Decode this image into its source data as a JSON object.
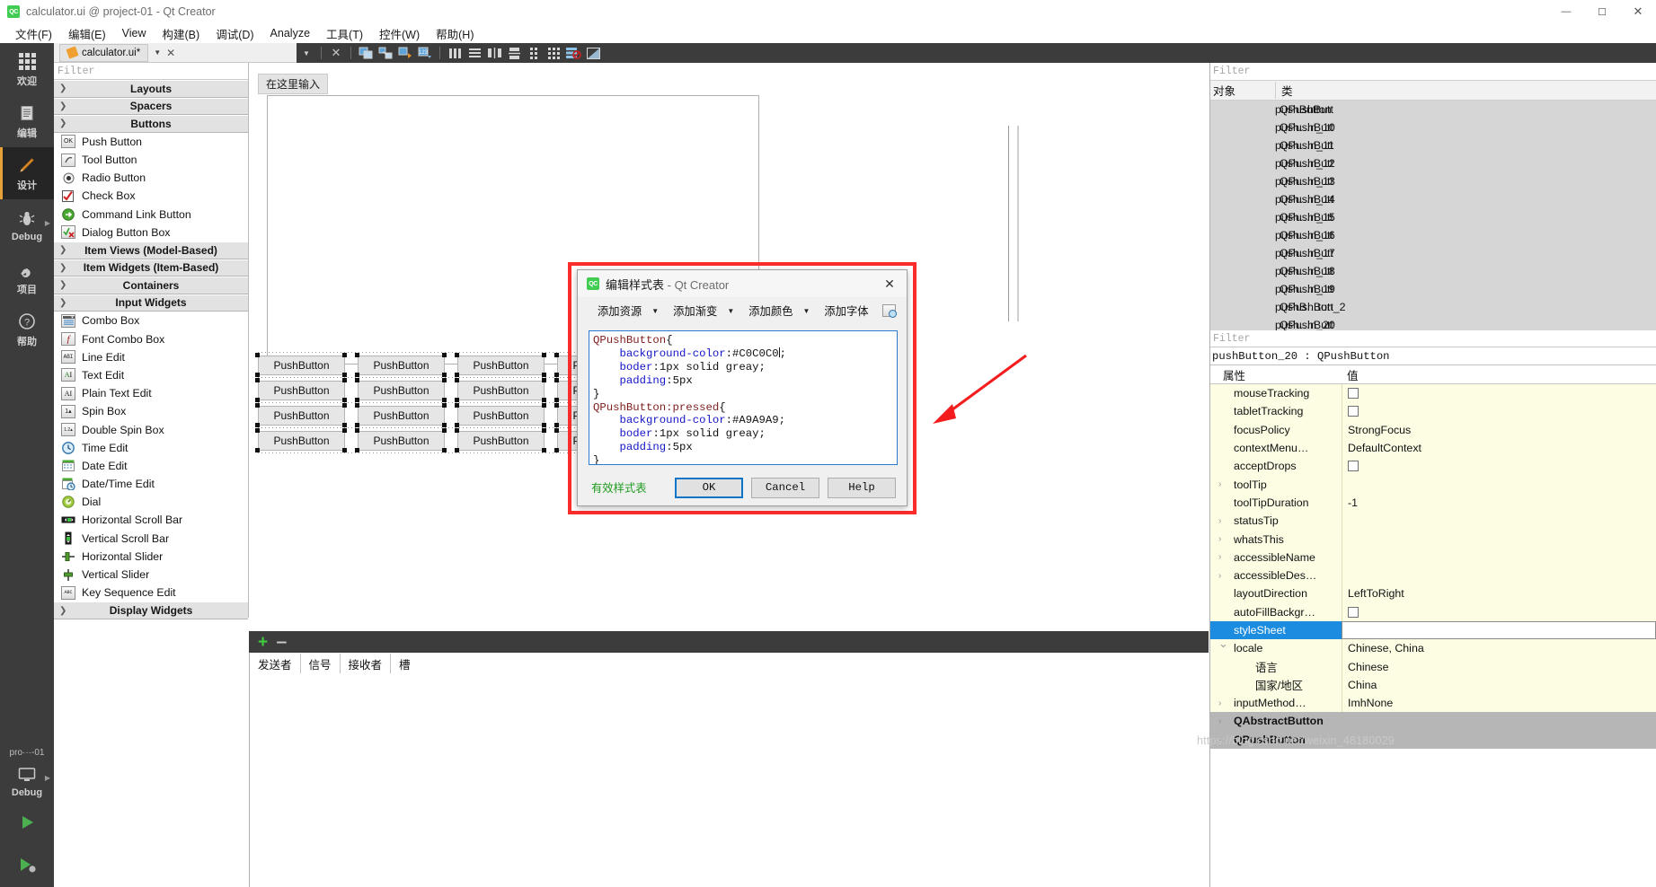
{
  "window": {
    "title": "calculator.ui @ project-01 - Qt Creator",
    "logo_text": "QC",
    "minimize": "—",
    "maximize": "☐",
    "close": "✕"
  },
  "menubar": {
    "items": [
      {
        "label": "文件(F)"
      },
      {
        "label": "编辑(E)"
      },
      {
        "label": "View"
      },
      {
        "label": "构建(B)"
      },
      {
        "label": "调试(D)"
      },
      {
        "label": "Analyze"
      },
      {
        "label": "工具(T)"
      },
      {
        "label": "控件(W)"
      },
      {
        "label": "帮助(H)"
      }
    ]
  },
  "modebar": {
    "items": [
      {
        "label": "欢迎",
        "icon": "grid-icon",
        "active": false,
        "arrow": false
      },
      {
        "label": "编辑",
        "icon": "document-icon",
        "active": false,
        "arrow": false
      },
      {
        "label": "设计",
        "icon": "pencil-icon",
        "active": true,
        "arrow": false
      },
      {
        "label": "Debug",
        "icon": "bug-icon",
        "active": false,
        "arrow": true
      },
      {
        "label": "项目",
        "icon": "wrench-icon",
        "active": false,
        "arrow": false
      },
      {
        "label": "帮助",
        "icon": "help-icon",
        "active": false,
        "arrow": false
      }
    ],
    "bottom": {
      "project_label": "pro···-01",
      "debug_label": "Debug",
      "run_icon": "play-icon",
      "debug_icon": "play-bug-icon"
    }
  },
  "editor_tab": {
    "filename": "calculator.ui*",
    "close_icon": "close-icon",
    "dropdown_icon": "chevron-down-icon"
  },
  "designer_toolbar": {
    "icons": [
      "chevron-down-icon",
      "close-icon",
      "edit-widgets-icon",
      "edit-signals-icon",
      "edit-buddies-icon",
      "edit-tab-order-icon",
      "layout-horizontal-icon",
      "layout-vertical-icon",
      "layout-splitter-h-icon",
      "layout-splitter-v-icon",
      "layout-form-icon",
      "layout-grid-icon",
      "break-layout-icon",
      "adjust-size-icon"
    ]
  },
  "widget_box": {
    "filter_placeholder": "Filter",
    "groups": [
      {
        "label": "Layouts",
        "expanded": false,
        "items": []
      },
      {
        "label": "Spacers",
        "expanded": false,
        "items": []
      },
      {
        "label": "Buttons",
        "expanded": true,
        "items": [
          {
            "label": "Push Button",
            "icon": "push-button-icon"
          },
          {
            "label": "Tool Button",
            "icon": "tool-button-icon"
          },
          {
            "label": "Radio Button",
            "icon": "radio-button-icon"
          },
          {
            "label": "Check Box",
            "icon": "check-box-icon"
          },
          {
            "label": "Command Link Button",
            "icon": "command-link-icon"
          },
          {
            "label": "Dialog Button Box",
            "icon": "dialog-button-box-icon"
          }
        ]
      },
      {
        "label": "Item Views (Model-Based)",
        "expanded": false,
        "items": []
      },
      {
        "label": "Item Widgets (Item-Based)",
        "expanded": false,
        "items": []
      },
      {
        "label": "Containers",
        "expanded": false,
        "items": []
      },
      {
        "label": "Input Widgets",
        "expanded": true,
        "items": [
          {
            "label": "Combo Box",
            "icon": "combo-box-icon"
          },
          {
            "label": "Font Combo Box",
            "icon": "font-combo-box-icon"
          },
          {
            "label": "Line Edit",
            "icon": "line-edit-icon"
          },
          {
            "label": "Text Edit",
            "icon": "text-edit-icon"
          },
          {
            "label": "Plain Text Edit",
            "icon": "plain-text-edit-icon"
          },
          {
            "label": "Spin Box",
            "icon": "spin-box-icon"
          },
          {
            "label": "Double Spin Box",
            "icon": "double-spin-box-icon"
          },
          {
            "label": "Time Edit",
            "icon": "time-edit-icon"
          },
          {
            "label": "Date Edit",
            "icon": "date-edit-icon"
          },
          {
            "label": "Date/Time Edit",
            "icon": "date-time-edit-icon"
          },
          {
            "label": "Dial",
            "icon": "dial-icon"
          },
          {
            "label": "Horizontal Scroll Bar",
            "icon": "h-scrollbar-icon"
          },
          {
            "label": "Vertical Scroll Bar",
            "icon": "v-scrollbar-icon"
          },
          {
            "label": "Horizontal Slider",
            "icon": "h-slider-icon"
          },
          {
            "label": "Vertical Slider",
            "icon": "v-slider-icon"
          },
          {
            "label": "Key Sequence Edit",
            "icon": "key-sequence-icon"
          }
        ]
      },
      {
        "label": "Display Widgets",
        "expanded": false,
        "items": []
      }
    ]
  },
  "form_canvas": {
    "menu_placeholder": "在这里输入",
    "button_label": "PushButton",
    "button_rows": 4,
    "button_cols": 4
  },
  "signal_pane": {
    "add_icon": "plus-icon",
    "remove_icon": "minus-icon",
    "columns": [
      "发送者",
      "信号",
      "接收者",
      "槽"
    ]
  },
  "object_inspector": {
    "filter_placeholder": "Filter",
    "columns": [
      "对象",
      "类"
    ],
    "rows": [
      {
        "name": "pushButton",
        "class": "QPushButt"
      },
      {
        "name": "push…n_10",
        "class": "QPushButt"
      },
      {
        "name": "push…n_11",
        "class": "QPushButt"
      },
      {
        "name": "push…n_12",
        "class": "QPushButt"
      },
      {
        "name": "push…n_13",
        "class": "QPushButt"
      },
      {
        "name": "push…n_14",
        "class": "QPushButt"
      },
      {
        "name": "push…n_15",
        "class": "QPushButt"
      },
      {
        "name": "push…n_16",
        "class": "QPushButt"
      },
      {
        "name": "push…n_17",
        "class": "QPushButt"
      },
      {
        "name": "push…n_18",
        "class": "QPushButt"
      },
      {
        "name": "push…n_19",
        "class": "QPushButt"
      },
      {
        "name": "pushB…ton_2",
        "class": "QPushButt"
      },
      {
        "name": "push…n_20",
        "class": "QPushButt"
      }
    ]
  },
  "property_editor": {
    "filter_placeholder": "Filter",
    "object_line": "pushButton_20 : QPushButton",
    "columns": [
      "属性",
      "值"
    ],
    "rows": [
      {
        "name": "mouseTracking",
        "value": "",
        "type": "checkbox",
        "expandable": false,
        "selected": false
      },
      {
        "name": "tabletTracking",
        "value": "",
        "type": "checkbox",
        "expandable": false,
        "selected": false
      },
      {
        "name": "focusPolicy",
        "value": "StrongFocus",
        "type": "text",
        "expandable": false,
        "selected": false
      },
      {
        "name": "contextMenu…",
        "value": "DefaultContext",
        "type": "text",
        "expandable": false,
        "selected": false
      },
      {
        "name": "acceptDrops",
        "value": "",
        "type": "checkbox",
        "expandable": false,
        "selected": false
      },
      {
        "name": "toolTip",
        "value": "",
        "type": "text",
        "expandable": true,
        "selected": false
      },
      {
        "name": "toolTipDuration",
        "value": "-1",
        "type": "text",
        "expandable": false,
        "selected": false
      },
      {
        "name": "statusTip",
        "value": "",
        "type": "text",
        "expandable": true,
        "selected": false
      },
      {
        "name": "whatsThis",
        "value": "",
        "type": "text",
        "expandable": true,
        "selected": false
      },
      {
        "name": "accessibleName",
        "value": "",
        "type": "text",
        "expandable": true,
        "selected": false
      },
      {
        "name": "accessibleDes…",
        "value": "",
        "type": "text",
        "expandable": true,
        "selected": false
      },
      {
        "name": "layoutDirection",
        "value": "LeftToRight",
        "type": "text",
        "expandable": false,
        "selected": false
      },
      {
        "name": "autoFillBackgr…",
        "value": "",
        "type": "checkbox",
        "expandable": false,
        "selected": false
      },
      {
        "name": "styleSheet",
        "value": "",
        "type": "edit",
        "expandable": false,
        "selected": true
      },
      {
        "name": "locale",
        "value": "Chinese, China",
        "type": "text",
        "expandable": true,
        "expanded": true,
        "selected": false
      },
      {
        "name": "语言",
        "value": "Chinese",
        "type": "text",
        "expandable": false,
        "selected": false,
        "indent": true
      },
      {
        "name": "国家/地区",
        "value": "China",
        "type": "text",
        "expandable": false,
        "selected": false,
        "indent": true
      },
      {
        "name": "inputMethod…",
        "value": "ImhNone",
        "type": "text",
        "expandable": true,
        "selected": false
      },
      {
        "name": "QAbstractButton",
        "value": "",
        "type": "group",
        "expandable": true,
        "selected": false
      },
      {
        "name": "QPushButton",
        "value": "",
        "type": "group",
        "expandable": true,
        "selected": false
      }
    ]
  },
  "stylesheet_dialog": {
    "logo_text": "QC",
    "title": "编辑样式表",
    "title_suffix": " - Qt Creator",
    "close_icon": "close-icon",
    "toolbar": [
      {
        "label": "添加资源",
        "has_caret": true
      },
      {
        "label": "添加渐变",
        "has_caret": true
      },
      {
        "label": "添加颜色",
        "has_caret": true
      },
      {
        "label": "添加字体",
        "has_caret": false
      }
    ],
    "font_icon": "font-picker-icon",
    "code_lines": [
      [
        {
          "t": "QPushButton",
          "c": "sel"
        },
        {
          "t": "{",
          "c": "plain"
        }
      ],
      [
        {
          "t": "    ",
          "c": "plain"
        },
        {
          "t": "background-color",
          "c": "prop"
        },
        {
          "t": ":#C0C0C0",
          "c": "plain"
        },
        {
          "t": "|",
          "c": "caret"
        },
        {
          "t": ";",
          "c": "plain"
        }
      ],
      [
        {
          "t": "    ",
          "c": "plain"
        },
        {
          "t": "boder",
          "c": "prop"
        },
        {
          "t": ":1px solid greay;",
          "c": "plain"
        }
      ],
      [
        {
          "t": "    ",
          "c": "plain"
        },
        {
          "t": "padding",
          "c": "prop"
        },
        {
          "t": ":5px",
          "c": "plain"
        }
      ],
      [
        {
          "t": "}",
          "c": "plain"
        }
      ],
      [
        {
          "t": "QPushButton:pressed",
          "c": "sel"
        },
        {
          "t": "{",
          "c": "plain"
        }
      ],
      [
        {
          "t": "    ",
          "c": "plain"
        },
        {
          "t": "background-color",
          "c": "prop"
        },
        {
          "t": ":#A9A9A9;",
          "c": "plain"
        }
      ],
      [
        {
          "t": "    ",
          "c": "plain"
        },
        {
          "t": "boder",
          "c": "prop"
        },
        {
          "t": ":1px solid greay;",
          "c": "plain"
        }
      ],
      [
        {
          "t": "    ",
          "c": "plain"
        },
        {
          "t": "padding",
          "c": "prop"
        },
        {
          "t": ":5px",
          "c": "plain"
        }
      ],
      [
        {
          "t": "}",
          "c": "plain"
        }
      ]
    ],
    "valid_text": "有效样式表",
    "buttons": [
      {
        "label": "OK",
        "primary": true
      },
      {
        "label": "Cancel",
        "primary": false
      },
      {
        "label": "Help",
        "primary": false
      }
    ]
  },
  "annotation": {
    "arrow_color": "#f41c1c",
    "highlight_color": "#fb2c2c"
  },
  "watermark": "https://blog.csdn.net/weixin_48180029"
}
